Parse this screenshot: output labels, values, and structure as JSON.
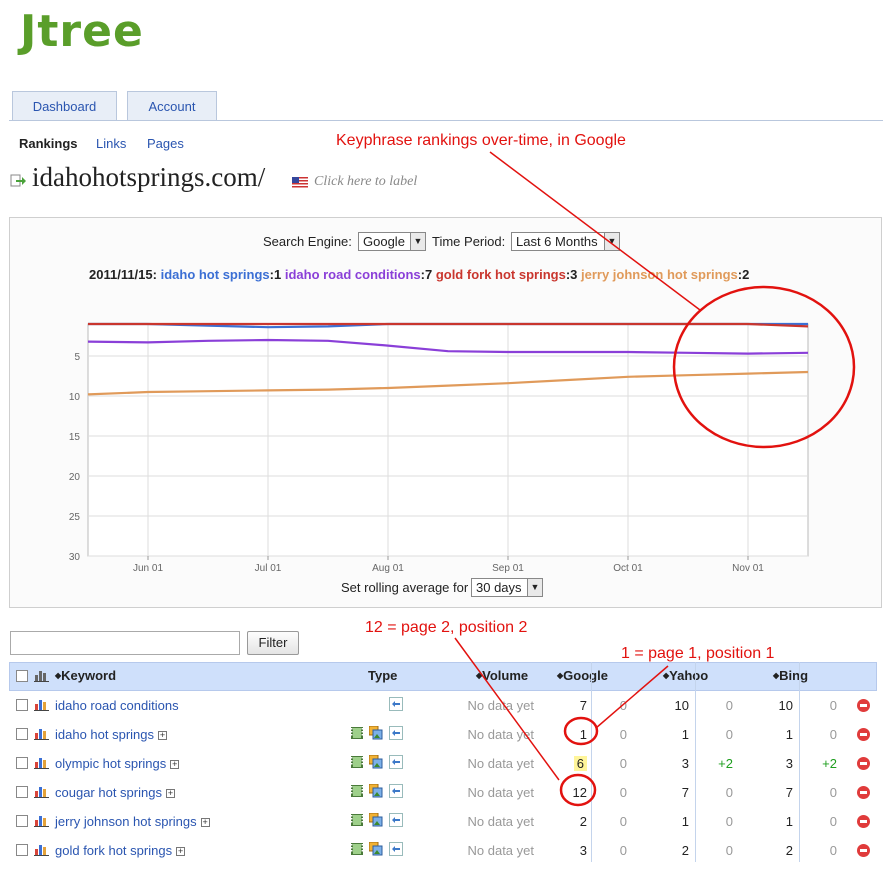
{
  "logo": {
    "text": "Jtree"
  },
  "tabs": [
    {
      "label": "Dashboard"
    },
    {
      "label": "Account"
    }
  ],
  "subnav": [
    {
      "label": "Rankings"
    },
    {
      "label": "Links"
    },
    {
      "label": "Pages"
    }
  ],
  "site": {
    "title": "idahohotsprings.com/",
    "label_hint": "Click here to label"
  },
  "controls": {
    "search_engine_label": "Search Engine:",
    "search_engine_value": "Google",
    "time_period_label": "Time Period:",
    "time_period_value": "Last 6 Months",
    "rolling_label": "Set rolling average for",
    "rolling_value": "30 days"
  },
  "legend": {
    "date": "2011/11/15:",
    "entries": [
      {
        "name": "idaho hot springs",
        "value": ":1",
        "color": "#3b6fd4"
      },
      {
        "name": "idaho road conditions",
        "value": ":7",
        "color": "#8a3fd8"
      },
      {
        "name": "gold fork hot springs",
        "value": ":3",
        "color": "#c9362e"
      },
      {
        "name": "jerry johnson hot springs",
        "value": ":2",
        "color": "#e09a5a"
      }
    ]
  },
  "chart_data": {
    "type": "line",
    "xlabel": "",
    "ylabel": "",
    "x_ticks": [
      "Jun 01",
      "Jul 01",
      "Aug 01",
      "Sep 01",
      "Oct 01",
      "Nov 01"
    ],
    "y_ticks": [
      "5",
      "10",
      "15",
      "20",
      "25",
      "30"
    ],
    "ylim": [
      30,
      1
    ],
    "y_inverted": true,
    "grid": true,
    "x": [
      "May 15",
      "Jun 01",
      "Jun 15",
      "Jul 01",
      "Jul 15",
      "Aug 01",
      "Aug 15",
      "Sep 01",
      "Sep 15",
      "Oct 01",
      "Oct 15",
      "Nov 01",
      "Nov 15"
    ],
    "series": [
      {
        "name": "idaho hot springs",
        "color": "#3b6fd4",
        "values": [
          1,
          1,
          1.2,
          1.4,
          1.3,
          1,
          1,
          1,
          1,
          1,
          1,
          1,
          1
        ]
      },
      {
        "name": "idaho road conditions",
        "color": "#8a3fd8",
        "values": [
          3.2,
          3.3,
          3.1,
          3.0,
          3.1,
          3.7,
          4.4,
          4.5,
          4.5,
          4.5,
          4.6,
          4.7,
          4.6
        ]
      },
      {
        "name": "gold fork hot springs",
        "color": "#c9362e",
        "values": [
          1,
          1,
          1,
          1,
          1,
          1,
          1,
          1,
          1,
          1,
          1,
          1,
          1.3
        ]
      },
      {
        "name": "jerry johnson hot springs",
        "color": "#e09a5a",
        "values": [
          9.8,
          9.5,
          9.4,
          9.3,
          9.2,
          9.0,
          8.7,
          8.4,
          8.0,
          7.6,
          7.4,
          7.2,
          7.0
        ]
      }
    ]
  },
  "filter": {
    "button_label": "Filter",
    "placeholder": ""
  },
  "table": {
    "headers": {
      "keyword": "Keyword",
      "type": "Type",
      "volume": "Volume",
      "google": "Google",
      "yahoo": "Yahoo",
      "bing": "Bing"
    },
    "sort_icon": "◆",
    "rows": [
      {
        "keyword": "idaho road conditions",
        "expand": false,
        "type_icons": [
          "link-icon"
        ],
        "volume": "No data yet",
        "google": "7",
        "google_change": "0",
        "yahoo": "10",
        "yahoo_change": "0",
        "bing": "10",
        "bing_change": "0"
      },
      {
        "keyword": "idaho hot springs",
        "expand": true,
        "type_icons": [
          "video-icon",
          "image-icon",
          "link-icon"
        ],
        "volume": "No data yet",
        "google": "1",
        "google_change": "0",
        "yahoo": "1",
        "yahoo_change": "0",
        "bing": "1",
        "bing_change": "0"
      },
      {
        "keyword": "olympic hot springs",
        "expand": true,
        "type_icons": [
          "video-icon",
          "image-icon",
          "link-icon"
        ],
        "volume": "No data yet",
        "google": "6",
        "google_change": "0",
        "yahoo": "3",
        "yahoo_change": "+2",
        "bing": "3",
        "bing_change": "+2",
        "google_highlight": true
      },
      {
        "keyword": "cougar hot springs",
        "expand": true,
        "type_icons": [
          "video-icon",
          "image-icon",
          "link-icon"
        ],
        "volume": "No data yet",
        "google": "12",
        "google_change": "0",
        "yahoo": "7",
        "yahoo_change": "0",
        "bing": "7",
        "bing_change": "0"
      },
      {
        "keyword": "jerry johnson hot springs",
        "expand": true,
        "type_icons": [
          "video-icon",
          "image-icon",
          "link-icon"
        ],
        "volume": "No data yet",
        "google": "2",
        "google_change": "0",
        "yahoo": "1",
        "yahoo_change": "0",
        "bing": "1",
        "bing_change": "0"
      },
      {
        "keyword": "gold fork hot springs",
        "expand": true,
        "type_icons": [
          "video-icon",
          "image-icon",
          "link-icon"
        ],
        "volume": "No data yet",
        "google": "3",
        "google_change": "0",
        "yahoo": "2",
        "yahoo_change": "0",
        "bing": "2",
        "bing_change": "0"
      }
    ]
  },
  "annotations": {
    "chart_note": "Keyphrase rankings over-time, in Google",
    "page2_note": "12 = page 2, position 2",
    "page1_note": "1 = page 1, position 1",
    "color": "#e2120f"
  },
  "colors": {
    "link": "#2a55b0",
    "positive_change": "#1e9e1e",
    "muted": "#999999",
    "header_bg": "#cfe0fb"
  }
}
